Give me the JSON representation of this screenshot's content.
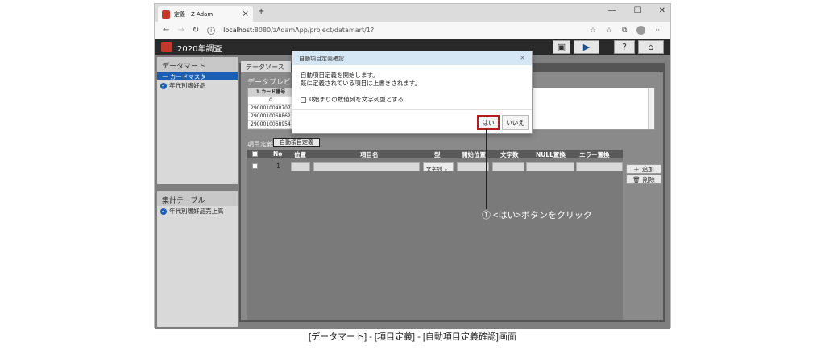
{
  "browser": {
    "tab_title": "定義 - Z-Adam",
    "tab_close": "×",
    "new_tab": "+",
    "win_min": "—",
    "win_max": "☐",
    "win_close": "✕",
    "url_host": "localhost",
    "url_path": ":8080/zAdamApp/project/datamart/1?",
    "more": "···"
  },
  "app": {
    "title": "2020年調査",
    "toolbar": [
      "save-icon",
      "run-icon",
      "help-icon",
      "home-icon"
    ]
  },
  "sidebar": {
    "datamart_header": "データマート",
    "datamart_selected": "ー カードマスタ",
    "datamart_items": [
      "年代別嗜好品"
    ],
    "aggregate_header": "集計テーブル",
    "aggregate_items": [
      "年代別嗜好品売上高"
    ]
  },
  "content": {
    "tab_label": "データソース",
    "preview_label": "データプレビュー",
    "preview_header": "1.カード番号",
    "preview_rows": [
      "0",
      "2900010040707",
      "2900010068862",
      "2900010068954"
    ],
    "itemdef_label": "項目定義",
    "auto_button": "自動項目定義",
    "grid_headers": {
      "no": "No",
      "pos": "位置",
      "name": "項目名",
      "type": "型",
      "start": "開始位置",
      "chars": "文字数",
      "null": "NULL置換",
      "error": "エラー置換"
    },
    "grid_row": {
      "no": "1",
      "type": "文字列"
    },
    "add_button": "追加",
    "delete_button": "削除"
  },
  "dialog": {
    "title": "自動項目定義確認",
    "close": "×",
    "message_line1": "自動項目定義を開始します。",
    "message_line2": "既に定義されている項目は上書きされます。",
    "option": "0始まりの数値列を文字列型とする",
    "yes": "はい",
    "no": "いいえ"
  },
  "annotation": "① <はい>ボタンをクリック",
  "caption": "[データマート] - [項目定義] - [自動項目定義確認]画面"
}
